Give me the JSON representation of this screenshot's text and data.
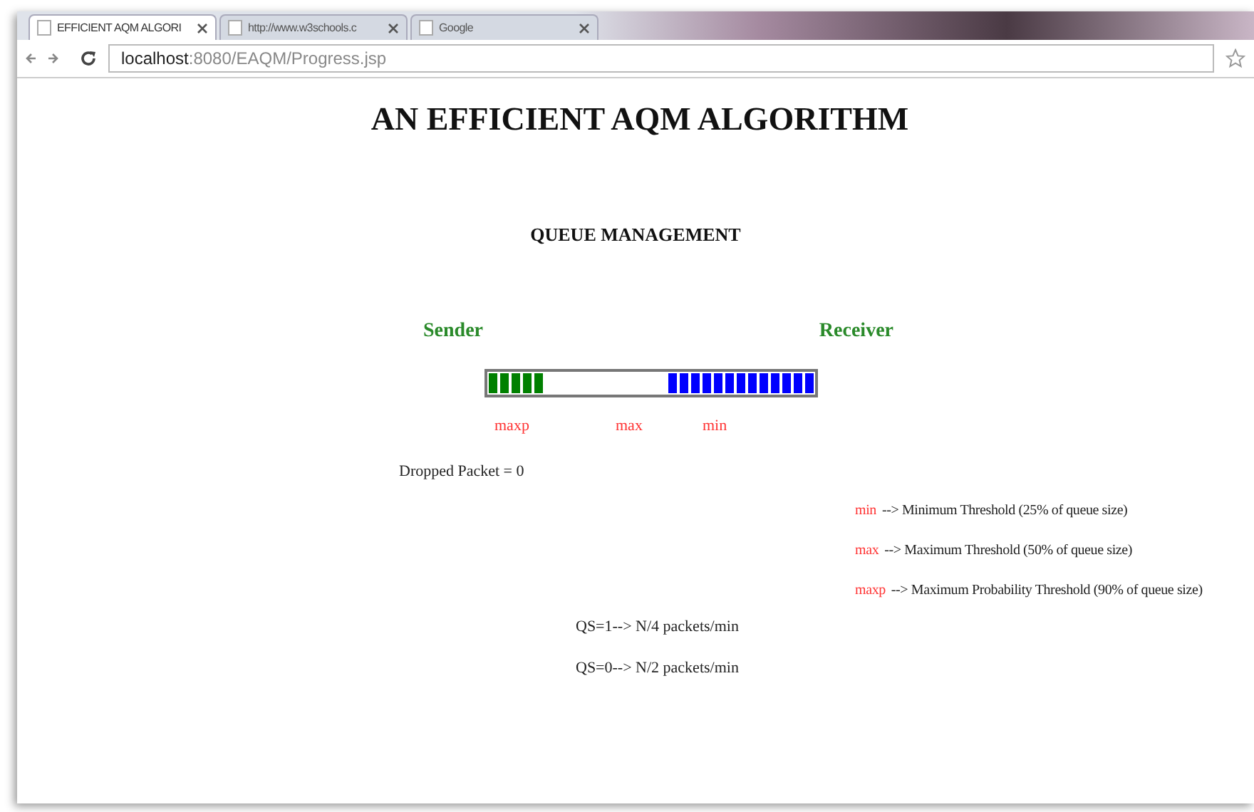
{
  "tabs": [
    {
      "label": "EFFICIENT AQM ALGORI",
      "selected": true
    },
    {
      "label": "http://www.w3schools.c",
      "selected": false
    },
    {
      "label": "Google",
      "selected": false
    }
  ],
  "address": {
    "host": "localhost",
    "path": ":8080/EAQM/Progress.jsp"
  },
  "title": "AN EFFICIENT AQM ALGORITHM",
  "subtitle": "QUEUE MANAGEMENT",
  "sender": "Sender",
  "receiver": "Receiver",
  "queue": {
    "sender_packets": [
      {
        "color": "#008000"
      },
      {
        "color": "#008000"
      },
      {
        "color": "#008000"
      },
      {
        "color": "#008000"
      },
      {
        "color": "#008000"
      }
    ],
    "receiver_packets": [
      {
        "color": "#0000ff"
      },
      {
        "color": "#0000ff"
      },
      {
        "color": "#0000ff"
      },
      {
        "color": "#0000ff"
      },
      {
        "color": "#0000ff"
      },
      {
        "color": "#0000ff"
      },
      {
        "color": "#0000ff"
      },
      {
        "color": "#0000ff"
      },
      {
        "color": "#0000ff"
      },
      {
        "color": "#0000ff"
      },
      {
        "color": "#0000ff"
      },
      {
        "color": "#0000ff"
      },
      {
        "color": "#0000ff"
      }
    ]
  },
  "markers": [
    "maxp",
    "max",
    "min"
  ],
  "dropped": "Dropped Packet = 0",
  "legend": [
    {
      "key": "min",
      "text": "--> Minimum Threshold (25% of queue size)"
    },
    {
      "key": "max",
      "text": "--> Maximum Threshold (50% of queue size)"
    },
    {
      "key": "maxp",
      "text": "--> Maximum Probability Threshold (90% of queue size)"
    }
  ],
  "rates": [
    "QS=1--> N/4 packets/min",
    "QS=0--> N/2 packets/min"
  ]
}
